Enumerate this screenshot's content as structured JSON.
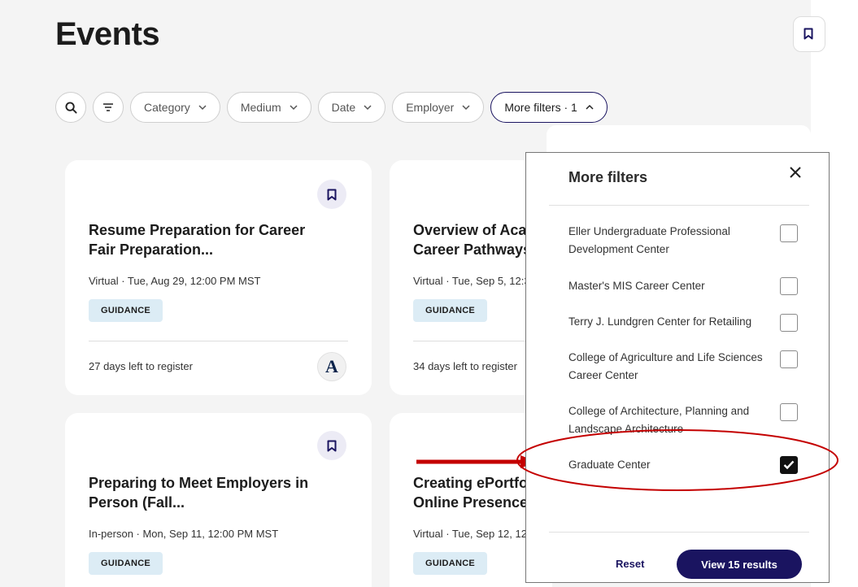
{
  "page": {
    "title": "Events"
  },
  "filters": {
    "pills": [
      {
        "label": "Category"
      },
      {
        "label": "Medium"
      },
      {
        "label": "Date"
      },
      {
        "label": "Employer"
      }
    ],
    "more_filters": "More filters · 1"
  },
  "cards": [
    {
      "title": "Resume Preparation for Career Fair Preparation...",
      "meta": "Virtual · Tue, Aug 29, 12:00 PM MST",
      "tag": "GUIDANCE",
      "foot": "27 days left to register",
      "logo": "A"
    },
    {
      "title": "Overview of Aca Career Pathways",
      "meta": "Virtual · Tue, Sep 5, 12:30",
      "tag": "GUIDANCE",
      "foot": "34 days left to register"
    },
    {
      "title": "Preparing to Meet Employers in Person (Fall...",
      "meta": "In-person · Mon, Sep 11, 12:00 PM MST",
      "tag": "GUIDANCE"
    },
    {
      "title": "Creating ePortfo Online Presence",
      "meta": "Virtual · Tue, Sep 12, 12:3",
      "tag": "GUIDANCE"
    }
  ],
  "panel": {
    "title": "More filters",
    "options": [
      {
        "label": "Eller Undergraduate Professional Development Center",
        "checked": false
      },
      {
        "label": "Master's MIS Career Center",
        "checked": false
      },
      {
        "label": "Terry J. Lundgren Center for Retailing",
        "checked": false
      },
      {
        "label": "College of Agriculture and Life Sciences Career Center",
        "checked": false
      },
      {
        "label": "College of Architecture, Planning and Landscape Architecture",
        "checked": false
      },
      {
        "label": "Graduate Center",
        "checked": true
      }
    ],
    "reset_label": "Reset",
    "view_label": "View 15 results"
  },
  "colors": {
    "brand": "#1a1460",
    "tag_bg": "#dcecf5",
    "annotation": "#cc0000"
  }
}
